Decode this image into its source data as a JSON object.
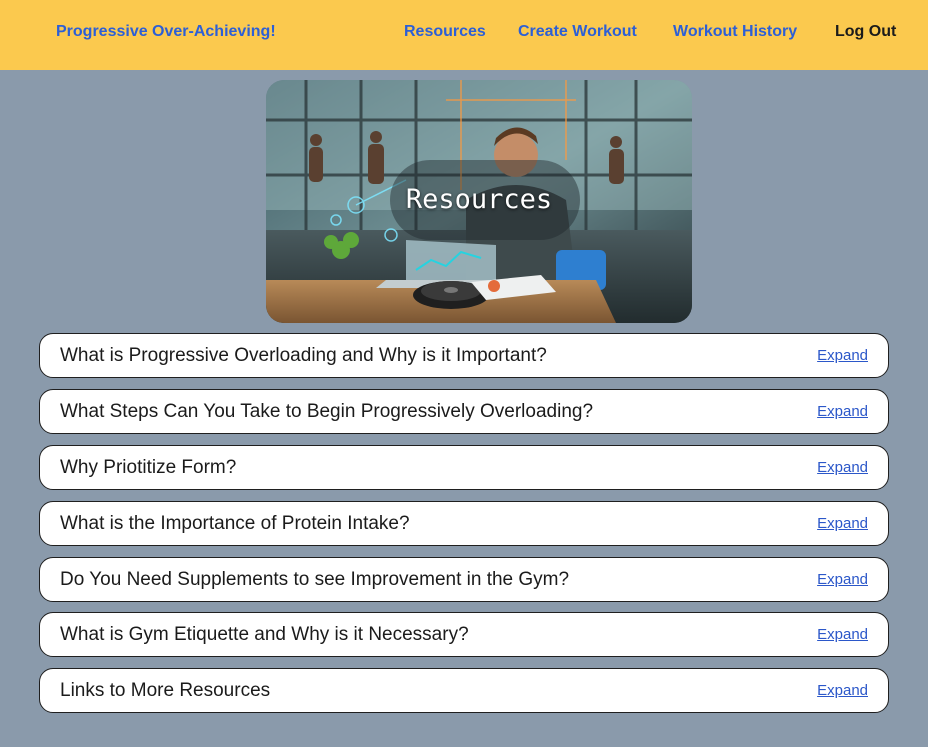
{
  "navbar": {
    "brand": "Progressive Over-Achieving!",
    "links": [
      "Resources",
      "Create Workout",
      "Workout History",
      "Log Out"
    ]
  },
  "hero": {
    "title": "Resources",
    "image_description_icon": "gym-laptop-illustration"
  },
  "faq": [
    {
      "question": "What is Progressive Overloading and Why is it Important?",
      "action": "Expand"
    },
    {
      "question": "What Steps Can You Take to Begin Progressively Overloading?",
      "action": "Expand"
    },
    {
      "question": "Why Priotitize Form?",
      "action": "Expand"
    },
    {
      "question": "What is the Importance of Protein Intake?",
      "action": "Expand"
    },
    {
      "question": "Do You Need Supplements to see Improvement in the Gym?",
      "action": "Expand"
    },
    {
      "question": "What is Gym Etiquette and Why is it Necessary?",
      "action": "Expand"
    },
    {
      "question": "Links to More Resources",
      "action": "Expand"
    }
  ],
  "colors": {
    "background": "#8a9aab",
    "navbar": "#fbc94e",
    "nav_link": "#2c5fd6",
    "expand_link": "#2b57c9"
  }
}
